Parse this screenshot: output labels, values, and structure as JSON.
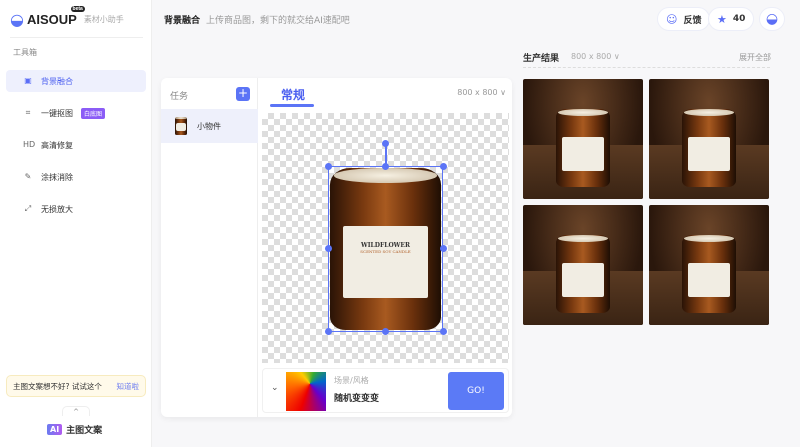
{
  "app": {
    "name": "AISOUP",
    "beta": "beta",
    "subtitle": "素材小助手"
  },
  "sidebar": {
    "section": "工具箱",
    "items": [
      {
        "label": "背景融合",
        "icon": "image-blend-icon",
        "active": true
      },
      {
        "label": "一键抠图",
        "icon": "cutout-icon",
        "badge": "白底图"
      },
      {
        "label": "高清修复",
        "icon": "hd-icon",
        "icon_text": "HD"
      },
      {
        "label": "涂抹消除",
        "icon": "brush-icon"
      },
      {
        "label": "无损放大",
        "icon": "expand-icon"
      }
    ],
    "tip": {
      "text": "主图文案想不好? 试试这个",
      "action": "知道啦"
    },
    "ai_button": {
      "badge": "AI",
      "label": "主图文案"
    }
  },
  "header": {
    "title": "背景融合",
    "subtitle": "上传商品图，剩下的就交给AI速配吧",
    "feedback": "反馈",
    "points": "40"
  },
  "panel": {
    "task_header": "任务",
    "task_item": "小物件",
    "tab": "常规",
    "size": "800 x 800 ∨",
    "product_label": "WILDFLOWER",
    "product_sub": "SCENTED SOY CANDLE",
    "style_label": "场景/风格",
    "style_value": "随机变变变",
    "go": "GO!"
  },
  "results": {
    "title": "生产结果",
    "size": "800 x 800 ∨",
    "expand": "展开全部",
    "count": 4
  },
  "colors": {
    "accent": "#5b74f6",
    "active_bg": "#eef0fd"
  }
}
